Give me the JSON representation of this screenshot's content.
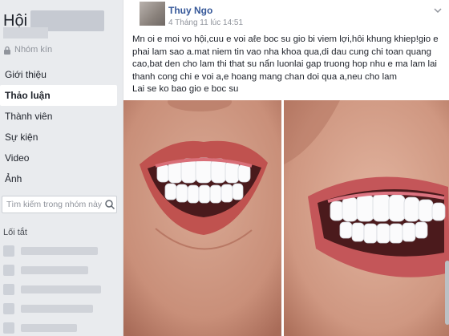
{
  "sidebar": {
    "group_name_prefix": "Hội",
    "privacy_label": "Nhóm kín",
    "nav": [
      {
        "label": "Giới thiệu"
      },
      {
        "label": "Thảo luận"
      },
      {
        "label": "Thành viên"
      },
      {
        "label": "Sự kiện"
      },
      {
        "label": "Video"
      },
      {
        "label": "Ảnh"
      }
    ],
    "active_index": 1,
    "search_placeholder": "Tìm kiếm trong nhóm này",
    "shortcuts_title": "Lối tắt"
  },
  "post": {
    "author": "Thuy Ngo",
    "timestamp": "4 Tháng 11 lúc 14:51",
    "text": "Mn oi e moi vo hội,cuu e voi aℓe boc su gio bi viem lợi,hôi khung khiep!gio e phai lam sao a.mat niem tin vao nha khoa qua,di dau cung chi toan quang cao,bat den cho lam thi that su nẩn luonlai gap truong hop nhu e ma lam lai thanh cong chi e voi a,e hoang mang chan doi qua a,neu cho lam\nLai se ko bao gio e boc su"
  },
  "colors": {
    "link_blue": "#365899",
    "page_bg": "#e9ebee"
  },
  "icons": [
    "lock-icon",
    "search-icon",
    "more-options-icon"
  ]
}
